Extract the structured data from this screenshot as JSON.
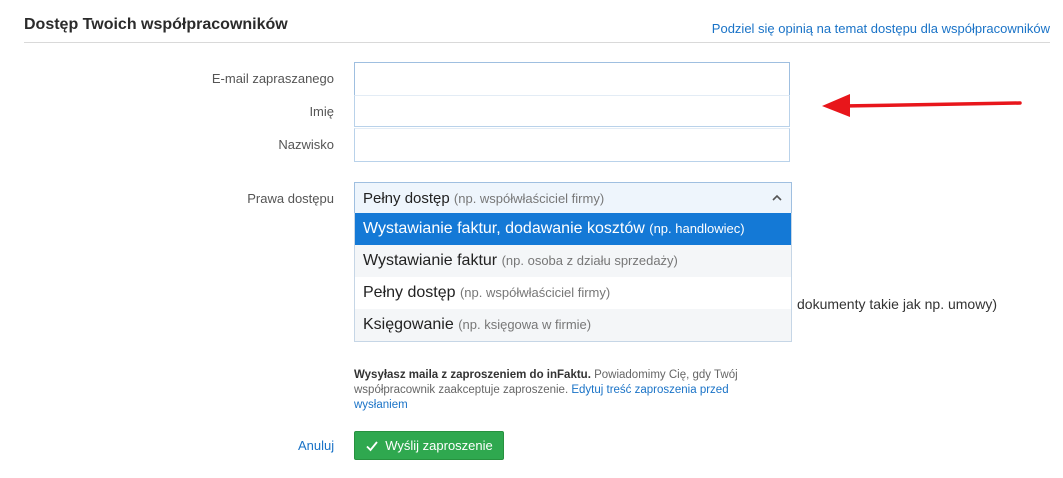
{
  "header": {
    "title": "Dostęp Twoich współpracowników",
    "feedback_link": "Podziel się opinią na temat dostępu dla współpracowników"
  },
  "form": {
    "email_label": "E-mail zapraszanego",
    "email_value": "",
    "first_name_label": "Imię",
    "first_name_value": "",
    "last_name_label": "Nazwisko",
    "last_name_value": "",
    "rights_label": "Prawa dostępu",
    "rights_selected": {
      "label": "Pełny dostęp",
      "hint": "(np. współwłaściciel firmy)"
    },
    "rights_options": [
      {
        "label": "Wystawianie faktur, dodawanie kosztów",
        "hint": "(np. handlowiec)",
        "highlighted": true
      },
      {
        "label": "Wystawianie faktur",
        "hint": "(np. osoba z działu sprzedaży)",
        "highlighted": false
      },
      {
        "label": "Pełny dostęp",
        "hint": "(np. współwłaściciel firmy)",
        "highlighted": false
      },
      {
        "label": "Księgowanie",
        "hint": "(np. księgowa w firmie)",
        "highlighted": false
      }
    ],
    "partially_hidden_text": "dokumenty takie jak np. umowy)"
  },
  "invite_note": {
    "bold": "Wysyłasz maila z zaproszeniem do inFaktu.",
    "text": " Powiadomimy Cię, gdy Twój współpracownik zaakceptuje zaproszenie. ",
    "link": "Edytuj treść zaproszenia przed wysłaniem"
  },
  "actions": {
    "cancel": "Anuluj",
    "send": "Wyślij zaproszenie"
  },
  "colors": {
    "accent": "#1479d6",
    "link": "#1a73c7",
    "send_button": "#2fa84f",
    "annotation_arrow": "#e8161b"
  },
  "icons": {
    "select_chevron": "chevron-up-icon",
    "send_button": "check-icon",
    "annotation": "arrow-left-icon"
  }
}
